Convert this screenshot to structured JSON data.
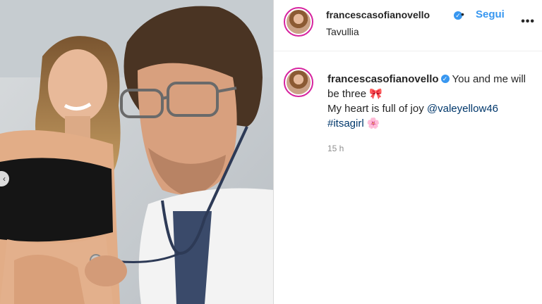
{
  "post": {
    "username": "francescasofianovello",
    "verified_icon": "verified-badge-icon",
    "separator": "•",
    "follow_label": "Segui",
    "location": "Tavullia",
    "more_icon": "•••",
    "caption": {
      "username": "francescasofianovello",
      "text_line1": "You and me will be three",
      "bow_emoji": "🎀",
      "text_line2": "My heart is full of joy",
      "mention": "@valeyellow46",
      "hashtag": "#itsagirl",
      "flower_emoji": "🌸"
    },
    "timestamp": "15 h"
  },
  "colors": {
    "accent_blue": "#3897f0",
    "link_blue": "#00376b",
    "text": "#262626",
    "muted": "#8e8e8e"
  }
}
